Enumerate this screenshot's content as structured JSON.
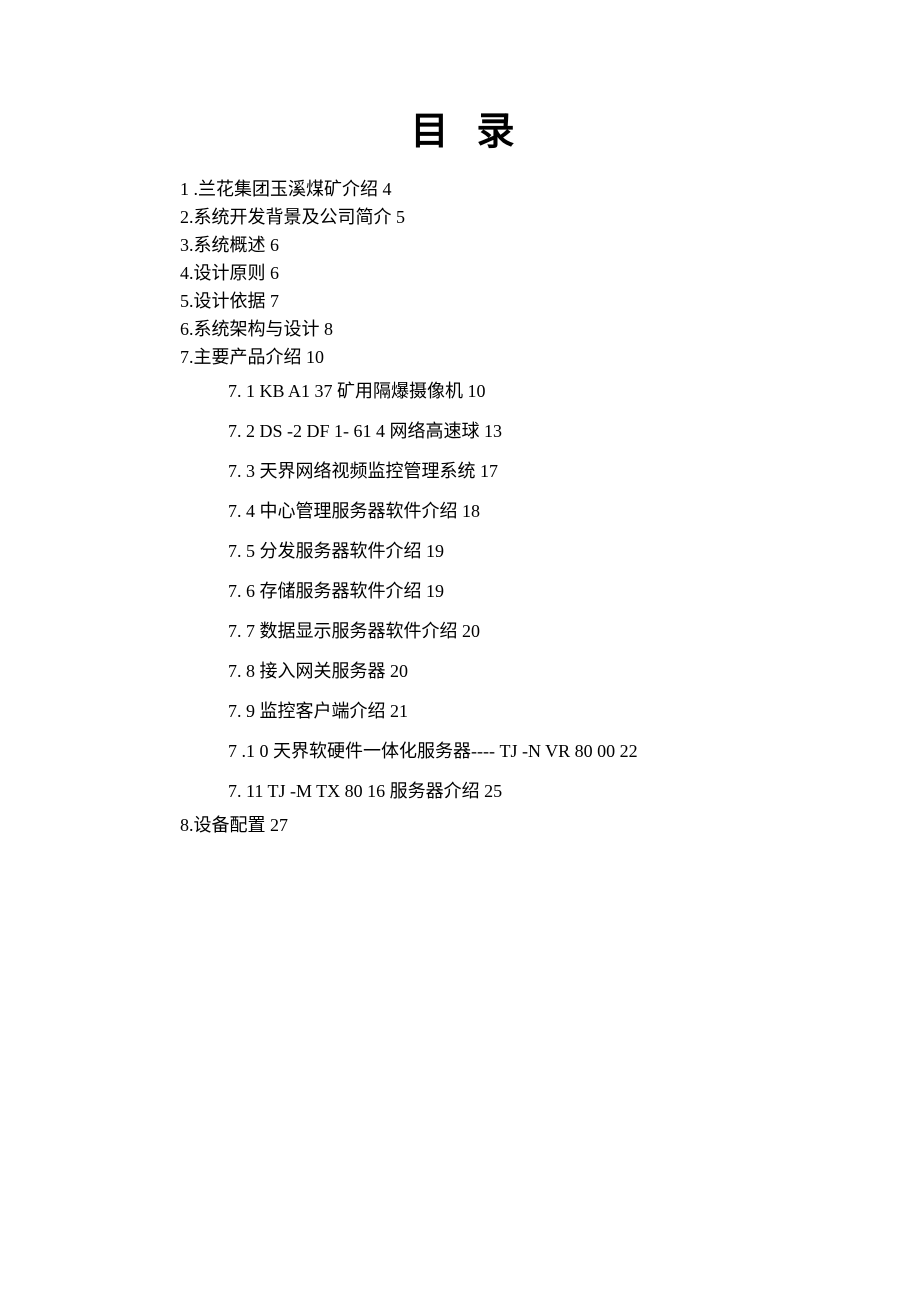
{
  "title_left": "目",
  "title_right": "录",
  "toc_level1": [
    "1 .兰花集团玉溪煤矿介绍 4",
    "2.系统开发背景及公司简介 5",
    "3.系统概述 6",
    "4.设计原则 6",
    "5.设计依据 7",
    "6.系统架构与设计 8",
    "7.主要产品介绍 10"
  ],
  "toc_level2": [
    "7. 1  KB  A1  37 矿用隔爆摄像机 10",
    "7. 2  DS -2  DF  1- 61  4 网络高速球 13",
    "7. 3 天界网络视频监控管理系统 17",
    "7. 4 中心管理服务器软件介绍 18",
    "7. 5 分发服务器软件介绍 19",
    "7. 6 存储服务器软件介绍 19",
    "7. 7 数据显示服务器软件介绍 20",
    "7. 8 接入网关服务器 20",
    "7. 9 监控客户端介绍 21",
    "7 .1  0 天界软硬件一体化服务器----  TJ -N  VR  80  00  22",
    "7. 11  TJ -M  TX  80  16 服务器介绍 25"
  ],
  "toc_tail": [
    "8.设备配置 27"
  ]
}
